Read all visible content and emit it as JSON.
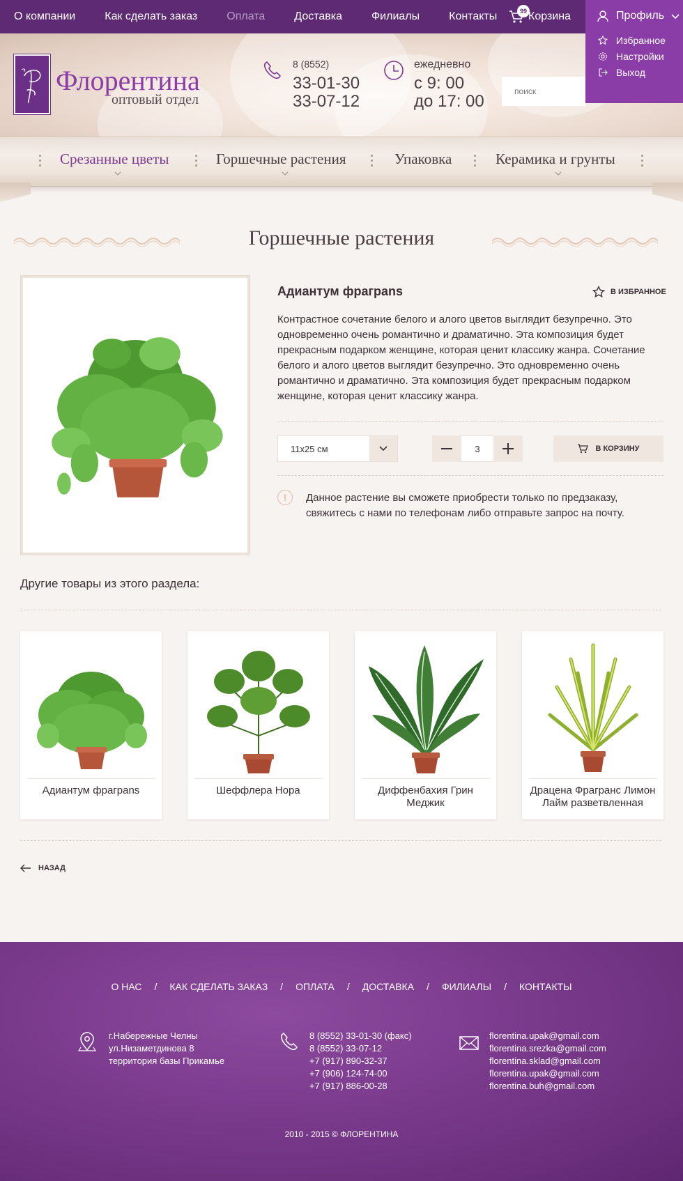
{
  "topnav": {
    "items": [
      {
        "label": "О компании",
        "active": false
      },
      {
        "label": "Как сделать заказ",
        "active": false
      },
      {
        "label": "Оплата",
        "active": true
      },
      {
        "label": "Доставка",
        "active": false
      },
      {
        "label": "Филиалы",
        "active": false
      },
      {
        "label": "Контакты",
        "active": false
      }
    ],
    "cart_label": "Корзина",
    "cart_count": "99"
  },
  "profile": {
    "label": "Профиль",
    "menu": [
      {
        "label": "Избранное",
        "icon": "star-icon"
      },
      {
        "label": "Настройки",
        "icon": "gear-icon"
      },
      {
        "label": "Выход",
        "icon": "logout-icon"
      }
    ]
  },
  "header": {
    "brand": "Флорентина",
    "brand_sub": "оптовый отдел",
    "phone_code": "8 (8552)",
    "phones": [
      "33-01-30",
      "33-07-12"
    ],
    "hours_label": "ежедневно",
    "hours": [
      "с 9: 00",
      "до 17: 00"
    ],
    "search_placeholder": "поиск"
  },
  "categories": [
    {
      "label": "Срезанные цветы",
      "active": true,
      "has_dropdown": true
    },
    {
      "label": "Горшечные растения",
      "active": false,
      "has_dropdown": true
    },
    {
      "label": "Упаковка",
      "active": false,
      "has_dropdown": false
    },
    {
      "label": "Керамика и грунты",
      "active": false,
      "has_dropdown": true
    }
  ],
  "page": {
    "title": "Горшечные растения"
  },
  "product": {
    "name": "Адиантум фраграns",
    "fav_label": "В ИЗБРАННОЕ",
    "description": "Контрастное сочетание белого и алого цветов выглядит безупречно. Это одновременно очень романтично и драматично. Эта композиция будет прекрасным подарком женщине, которая ценит классику жанра. Сочетание белого и алого цветов выглядит безупречно. Это одновременно очень романтично и драматично. Эта композиция будет прекрасным подарком женщине, которая ценит классику жанра.",
    "size": "11х25 см",
    "quantity": "3",
    "cart_button": "В КОРЗИНУ",
    "notice_mark": "!",
    "notice": "Данное растение вы сможете приобрести только по предзаказу, свяжитесь с нами по телефонам либо отправьте запрос на почту."
  },
  "other": {
    "title": "Другие товары из этого раздела:",
    "items": [
      {
        "name": "Адиантум фраграns"
      },
      {
        "name": "Шеффлера Нора"
      },
      {
        "name": "Диффенбахия Грин Меджик"
      },
      {
        "name": "Драцена Фрагранс Лимон Лайм разветвленная"
      }
    ],
    "back_label": "НАЗАД"
  },
  "footer": {
    "nav": [
      "О НАС",
      "КАК  СДЕЛАТЬ  ЗАКАЗ",
      "ОПЛАТА",
      "ДОСТАВКА",
      "ФИЛИАЛЫ",
      "КОНТАКТЫ"
    ],
    "nav_sep": "/",
    "address": [
      "г.Набережные Челны",
      "ул.Низаметдинова 8",
      "территория базы Прикамье"
    ],
    "phones": [
      "8 (8552) 33-01-30 (факс)",
      "8 (8552) 33-07-12",
      "+7 (917) 890-32-37",
      "+7 (906) 124-74-00",
      "+7 (917) 886-00-28"
    ],
    "emails": [
      "florentina.upak@gmail.com",
      "florentina.srezka@gmail.com",
      "florentina.sklad@gmail.com",
      "florentina.upak@gmail.com",
      "florentina.buh@gmail.com"
    ],
    "copyright": "2010 - 2015 © ФЛОРЕНТИНА"
  },
  "colors": {
    "topbar": "#5e2a74",
    "profile": "#8a3ca7",
    "brand": "#8a3ca7",
    "footer": "#7a3a8c"
  }
}
